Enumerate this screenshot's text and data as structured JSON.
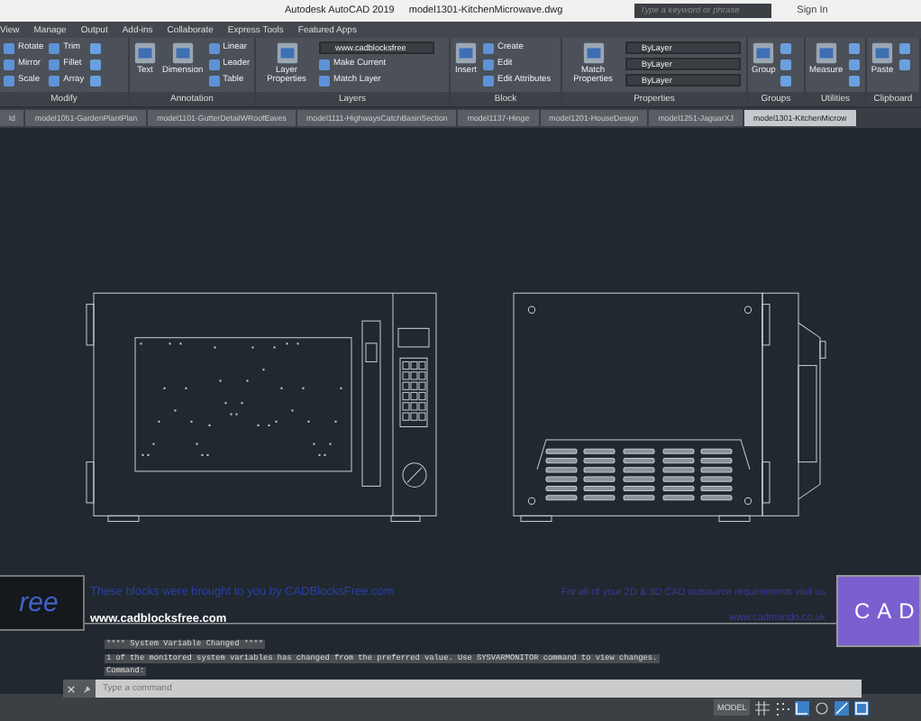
{
  "window": {
    "app_title": "Autodesk AutoCAD 2019",
    "document": "model1301-KitchenMicrowave.dwg",
    "search_placeholder": "Type a keyword or phrase",
    "sign_in": "Sign In"
  },
  "menu_tabs": [
    "View",
    "Manage",
    "Output",
    "Add-ins",
    "Collaborate",
    "Express Tools",
    "Featured Apps"
  ],
  "ribbon_panels": [
    {
      "title": "Modify",
      "columns": [
        [
          {
            "kind": "small",
            "label": "Rotate"
          },
          {
            "kind": "small",
            "label": "Mirror"
          },
          {
            "kind": "small",
            "label": "Scale"
          }
        ],
        [
          {
            "kind": "small",
            "label": "Trim"
          },
          {
            "kind": "small",
            "label": "Fillet"
          },
          {
            "kind": "small",
            "label": "Array"
          }
        ],
        [
          {
            "kind": "icon"
          },
          {
            "kind": "icon"
          },
          {
            "kind": "icon"
          }
        ]
      ]
    },
    {
      "title": "Annotation",
      "columns": [
        [
          {
            "kind": "large",
            "label": "Text"
          }
        ],
        [
          {
            "kind": "large",
            "label": "Dimension"
          }
        ],
        [
          {
            "kind": "small",
            "label": "Linear"
          },
          {
            "kind": "small",
            "label": "Leader"
          },
          {
            "kind": "small",
            "label": "Table"
          }
        ]
      ]
    },
    {
      "title": "Layers",
      "columns": [
        [
          {
            "kind": "large",
            "label": "Layer Properties"
          }
        ],
        [
          {
            "kind": "dropdown",
            "value": "www.cadblocksfree"
          },
          {
            "kind": "small",
            "label": "Make Current"
          },
          {
            "kind": "small",
            "label": "Match Layer"
          }
        ]
      ]
    },
    {
      "title": "Block",
      "columns": [
        [
          {
            "kind": "large",
            "label": "Insert"
          }
        ],
        [
          {
            "kind": "small",
            "label": "Create"
          },
          {
            "kind": "small",
            "label": "Edit"
          },
          {
            "kind": "small",
            "label": "Edit Attributes"
          }
        ]
      ]
    },
    {
      "title": "Properties",
      "columns": [
        [
          {
            "kind": "large",
            "label": "Match Properties"
          }
        ],
        [
          {
            "kind": "dropdown",
            "value": "ByLayer"
          },
          {
            "kind": "dropdown",
            "value": "ByLayer"
          },
          {
            "kind": "dropdown",
            "value": "ByLayer"
          }
        ]
      ]
    },
    {
      "title": "Groups",
      "columns": [
        [
          {
            "kind": "large",
            "label": "Group"
          }
        ],
        [
          {
            "kind": "icon"
          },
          {
            "kind": "icon"
          },
          {
            "kind": "icon"
          }
        ]
      ]
    },
    {
      "title": "Utilities",
      "columns": [
        [
          {
            "kind": "large",
            "label": "Measure"
          }
        ],
        [
          {
            "kind": "icon"
          },
          {
            "kind": "icon"
          },
          {
            "kind": "icon"
          }
        ]
      ]
    },
    {
      "title": "Clipboard",
      "columns": [
        [
          {
            "kind": "large",
            "label": "Paste"
          }
        ],
        [
          {
            "kind": "icon"
          },
          {
            "kind": "icon"
          }
        ]
      ]
    }
  ],
  "file_tabs": [
    {
      "label": "ld",
      "selected": false
    },
    {
      "label": "model1051-GardenPlantPlan",
      "selected": false
    },
    {
      "label": "model1101-GutterDetailWRoofEaves",
      "selected": false
    },
    {
      "label": "model1111-HighwaysCatchBasinSection",
      "selected": false
    },
    {
      "label": "model1137-Hinge",
      "selected": false
    },
    {
      "label": "model1201-HouseDesign",
      "selected": false
    },
    {
      "label": "model1251-JaguarXJ",
      "selected": false
    },
    {
      "label": "model1301-KitchenMicrow",
      "selected": true
    }
  ],
  "banner": {
    "logo_text": "ree",
    "credit": "These blocks were brought to you by CADBlocksFree.com",
    "credit_url": "www.cadblocksfree.com",
    "outsource": "For all of your 2D & 3D CAD outsource requirements visit us",
    "outsource_url": "www.cadmando.co.uk",
    "brand_box": "CAD"
  },
  "command_history": [
    "**** System Variable Changed ****",
    "1 of the monitored system variables has changed from the preferred value. Use SYSVARMONITOR command to view changes.",
    "Command:"
  ],
  "command_placeholder": "Type a command",
  "status_bar": {
    "model": "MODEL"
  }
}
